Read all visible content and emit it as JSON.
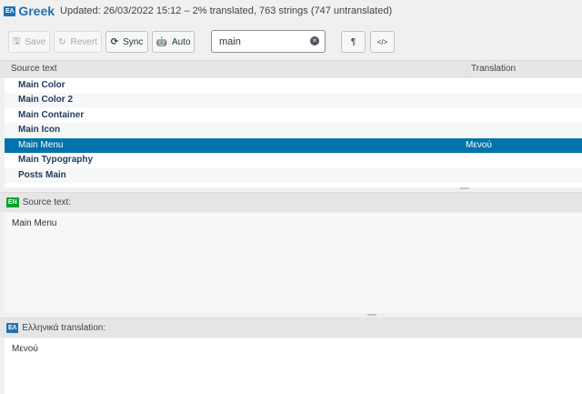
{
  "header": {
    "lang_code": "ΕΛ",
    "lang_name": "Greek",
    "meta": "Updated: 26/03/2022 15:12 – 2% translated, 763 strings (747 untranslated)"
  },
  "toolbar": {
    "save_label": "Save",
    "revert_label": "Revert",
    "sync_label": "Sync",
    "auto_label": "Auto",
    "pilcrow_label": "¶",
    "code_label": "</>"
  },
  "search": {
    "value": "main"
  },
  "list": {
    "headers": [
      "Source text",
      "Translation"
    ],
    "rows": [
      {
        "source": "Main Color",
        "translation": ""
      },
      {
        "source": "Main Color 2",
        "translation": ""
      },
      {
        "source": "Main Container",
        "translation": ""
      },
      {
        "source": "Main Icon",
        "translation": ""
      },
      {
        "source": "Main Menu",
        "translation": "Μενού"
      },
      {
        "source": "Main Typography",
        "translation": ""
      },
      {
        "source": "Posts Main",
        "translation": ""
      }
    ],
    "selected_index": 4
  },
  "source_panel": {
    "flag": "EN",
    "title": "Source text:",
    "content": "Main Menu"
  },
  "translation_panel": {
    "flag": "ΕΛ",
    "title": "Ελληνικά translation:",
    "content": "Μενού"
  },
  "colors": {
    "accent": "#2271b1",
    "selected_row": "#0073aa",
    "en_flag": "#00a32a"
  }
}
